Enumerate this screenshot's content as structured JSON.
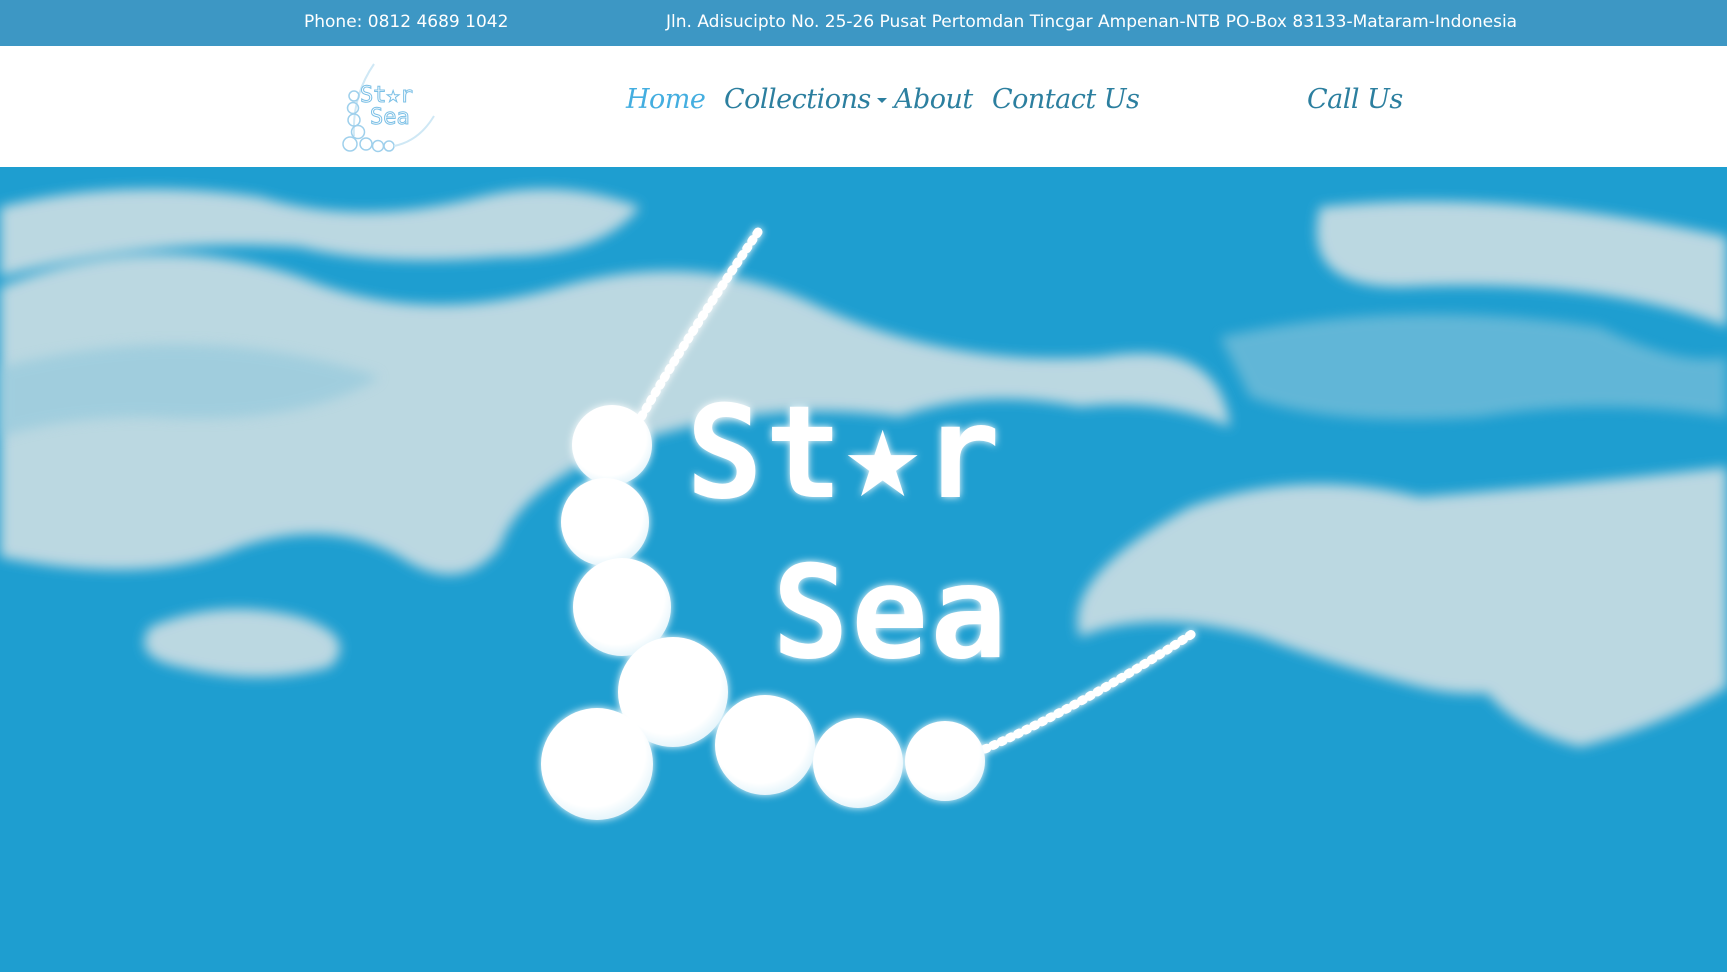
{
  "topbar": {
    "phone": "Phone: 0812 4689 1042",
    "address": "Jln. Adisucipto No. 25-26 Pusat Pertomdan Tincgar Ampenan-NTB PO-Box 83133-Mataram-Indonesia"
  },
  "logo": {
    "line1": "St★r",
    "line2": "Sea"
  },
  "nav": {
    "home": "Home",
    "collections": "Collections",
    "about": "About",
    "contact": "Contact Us",
    "call": "Call Us"
  },
  "hero": {
    "line1": "St★r",
    "line2": "Sea"
  },
  "colors": {
    "topbar": "#3d97c4",
    "nav_text": "#2c7f9f",
    "nav_active": "#44aee0",
    "sea": "#1e9ed0",
    "cloud": "#c9dde3"
  },
  "icons": [
    "caret-down-icon",
    "pearl-string-icon"
  ]
}
